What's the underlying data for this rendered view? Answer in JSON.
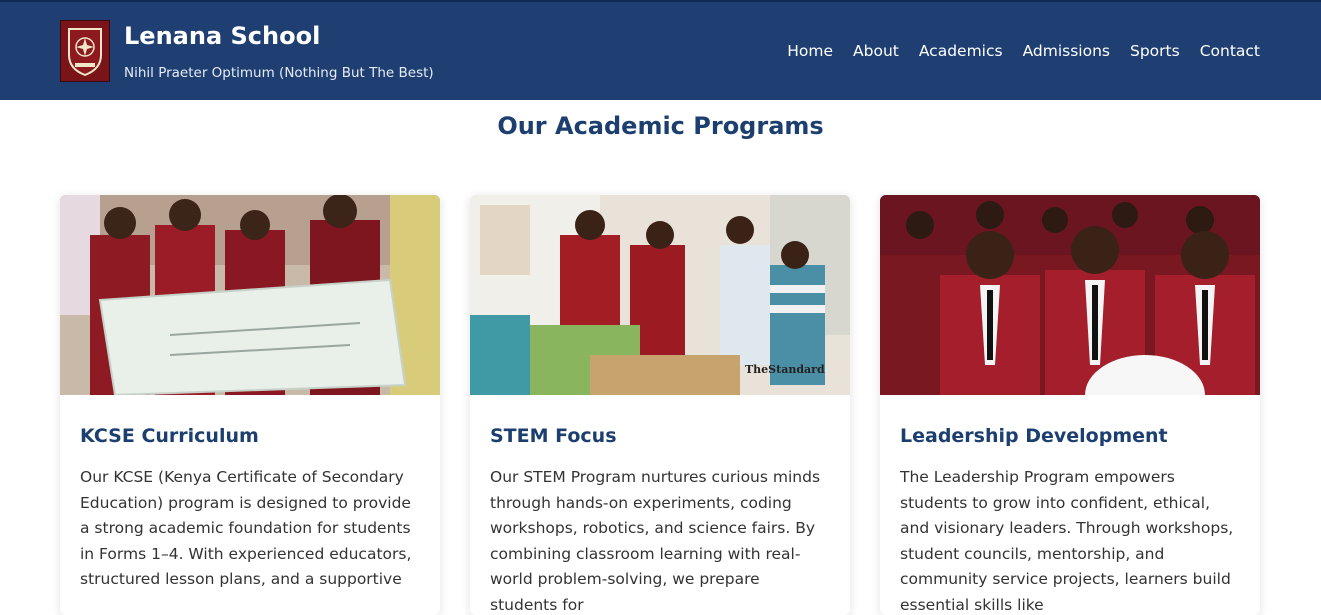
{
  "header": {
    "title": "Lenana School",
    "tagline": "Nihil Praeter Optimum (Nothing But The Best)",
    "nav": [
      "Home",
      "About",
      "Academics",
      "Admissions",
      "Sports",
      "Contact"
    ]
  },
  "section": {
    "title": "Our Academic Programs"
  },
  "cards": [
    {
      "title": "KCSE Curriculum",
      "text": "Our KCSE (Kenya Certificate of Secondary Education) program is designed to provide a strong academic foundation for students in Forms 1–4. With experienced educators, structured lesson plans, and a supportive",
      "image_caption": ""
    },
    {
      "title": "STEM Focus",
      "text": "Our STEM Program nurtures curious minds through hands-on experiments, coding workshops, robotics, and science fairs. By combining classroom learning with real-world problem-solving, we prepare students for",
      "image_caption": "TheStandard"
    },
    {
      "title": "Leadership Development",
      "text": "The Leadership Program empowers students to grow into confident, ethical, and visionary leaders. Through workshops, student councils, mentorship, and community service projects, learners build essential skills like",
      "image_caption": ""
    }
  ],
  "colors": {
    "header_bg": "#1f3f73",
    "title_blue": "#1c3f70",
    "blazer_red": "#9b1b26"
  }
}
